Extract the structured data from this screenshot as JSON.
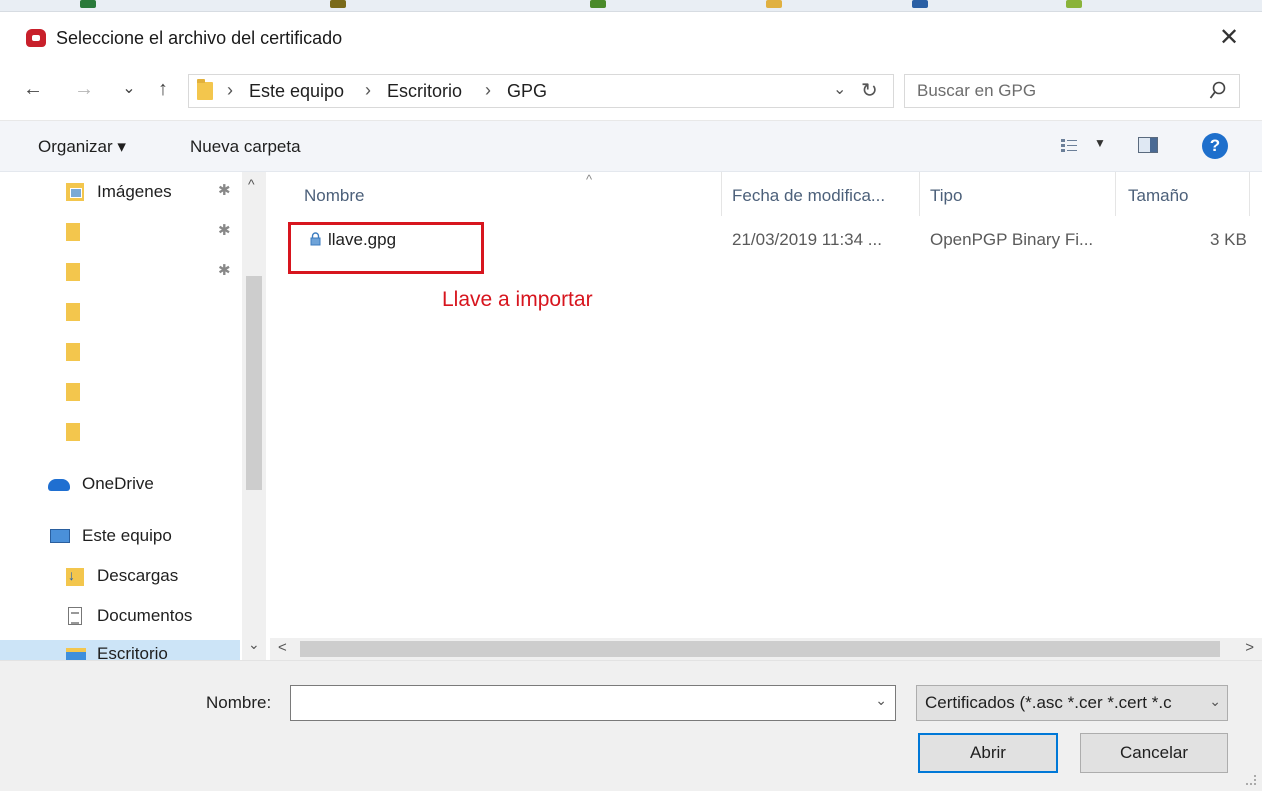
{
  "window": {
    "title": "Seleccione el archivo del certificado",
    "close_glyph": "✕"
  },
  "nav": {
    "back_glyph": "←",
    "forward_glyph": "→",
    "recent_glyph": "⌄",
    "up_glyph": "↑"
  },
  "address": {
    "crumbs": [
      "Este equipo",
      "Escritorio",
      "GPG"
    ],
    "separator": "›",
    "dropdown_glyph": "⌄",
    "refresh_glyph": "↻"
  },
  "search": {
    "placeholder": "Buscar en GPG"
  },
  "commandbar": {
    "organize_label": "Organizar ▾",
    "new_folder_label": "Nueva carpeta",
    "view_caret": "▼",
    "help_glyph": "?"
  },
  "navpane": {
    "items": [
      {
        "label": "Imágenes",
        "icon": "pictures-folder-icon",
        "pinned": true
      },
      {
        "label": "",
        "icon": "folder-icon",
        "pinned": true
      },
      {
        "label": "",
        "icon": "folder-icon",
        "pinned": true
      },
      {
        "label": "",
        "icon": "folder-icon",
        "pinned": false
      },
      {
        "label": "",
        "icon": "folder-icon",
        "pinned": false
      },
      {
        "label": "",
        "icon": "folder-icon",
        "pinned": false
      },
      {
        "label": "",
        "icon": "folder-icon",
        "pinned": false
      },
      {
        "label": "OneDrive",
        "icon": "onedrive-icon"
      },
      {
        "label": "Este equipo",
        "icon": "this-pc-icon"
      },
      {
        "label": "Descargas",
        "icon": "downloads-icon"
      },
      {
        "label": "Documentos",
        "icon": "documents-icon"
      },
      {
        "label": "Escritorio",
        "icon": "desktop-icon"
      }
    ],
    "pin_glyph": "📌"
  },
  "filelist": {
    "columns": [
      "Nombre",
      "Fecha de modifica...",
      "Tipo",
      "Tamaño"
    ],
    "sort_glyph": "^",
    "rows": [
      {
        "name": "llave.gpg",
        "date": "21/03/2019 11:34 ...",
        "type": "OpenPGP Binary Fi...",
        "size": "3 KB"
      }
    ],
    "annotation": "Llave a importar",
    "annotation_color": "#d7151e"
  },
  "footer": {
    "filename_label": "Nombre:",
    "filename_value": "",
    "filter_value": "Certificados (*.asc *.cer *.cert *.c",
    "open_label": "Abrir",
    "cancel_label": "Cancelar"
  },
  "colors": {
    "accent": "#0078d7",
    "help": "#1e6fcc",
    "folder": "#f3c64d"
  }
}
